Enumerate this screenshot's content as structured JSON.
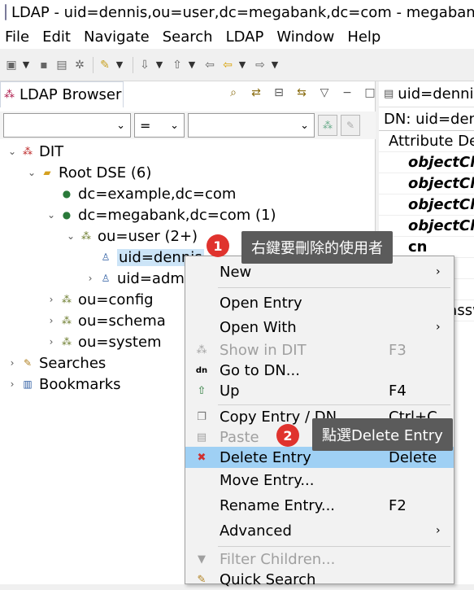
{
  "window": {
    "title": "LDAP - uid=dennis,ou=user,dc=megabank,dc=com - megabank - Apache Directory Studio"
  },
  "menubar": [
    "File",
    "Edit",
    "Navigate",
    "Search",
    "LDAP",
    "Window",
    "Help"
  ],
  "left_panel": {
    "tab_label": "LDAP Browser",
    "filter_combo_1": "",
    "filter_combo_2": "=",
    "filter_combo_3": "",
    "tree": {
      "dit": "DIT",
      "root_dse": "Root DSE (6)",
      "dc_example": "dc=example,dc=com",
      "dc_megabank": "dc=megabank,dc=com (1)",
      "ou_user": "ou=user (2+)",
      "uid_dennis": "uid=dennis",
      "uid_admin": "uid=admin",
      "ou_config": "ou=config",
      "ou_schema": "ou=schema",
      "ou_system": "ou=system",
      "searches": "Searches",
      "bookmarks": "Bookmarks"
    }
  },
  "right_panel": {
    "tab_label": "uid=dennis",
    "dn_label": "DN: uid=dennis",
    "header": "Attribute Description",
    "rows": [
      "objectClass",
      "objectClass",
      "objectClass",
      "objectClass",
      "cn",
      "",
      "",
      "userPassword"
    ]
  },
  "context_menu": {
    "items": [
      {
        "label": "New",
        "shortcut": "",
        "submenu": true,
        "disabled": false,
        "icon": ""
      },
      {
        "label": "Open Entry",
        "shortcut": "",
        "submenu": false,
        "disabled": false,
        "icon": ""
      },
      {
        "label": "Open With",
        "shortcut": "",
        "submenu": true,
        "disabled": false,
        "icon": ""
      },
      {
        "label": "Show in DIT",
        "shortcut": "F3",
        "submenu": false,
        "disabled": true,
        "icon": "show-in-dit-icon"
      },
      {
        "label": "Go to DN...",
        "shortcut": "",
        "submenu": false,
        "disabled": false,
        "icon": "goto-dn-icon"
      },
      {
        "label": "Up",
        "shortcut": "F4",
        "submenu": false,
        "disabled": false,
        "icon": "up-icon"
      },
      {
        "label": "Copy Entry / DN",
        "shortcut": "Ctrl+C",
        "submenu": false,
        "disabled": false,
        "icon": "copy-icon"
      },
      {
        "label": "Paste",
        "shortcut": "",
        "submenu": false,
        "disabled": true,
        "icon": "paste-icon"
      },
      {
        "label": "Delete Entry",
        "shortcut": "Delete",
        "submenu": false,
        "disabled": false,
        "icon": "delete-icon"
      },
      {
        "label": "Move Entry...",
        "shortcut": "",
        "submenu": false,
        "disabled": false,
        "icon": ""
      },
      {
        "label": "Rename Entry...",
        "shortcut": "F2",
        "submenu": false,
        "disabled": false,
        "icon": ""
      },
      {
        "label": "Advanced",
        "shortcut": "",
        "submenu": true,
        "disabled": false,
        "icon": ""
      },
      {
        "label": "Filter Children...",
        "shortcut": "",
        "submenu": false,
        "disabled": true,
        "icon": "filter-icon"
      },
      {
        "label": "Quick Search",
        "shortcut": "",
        "submenu": false,
        "disabled": false,
        "icon": "quick-search-icon"
      }
    ],
    "highlight_color": "#9fd0f4"
  },
  "annotations": [
    {
      "number": "1",
      "text": "右鍵要刪除的使用者"
    },
    {
      "number": "2",
      "text": "點選Delete Entry"
    }
  ],
  "colors": {
    "badge": "#e0332e",
    "callout_bg": "#5b5b5b",
    "selection": "#cce4f7"
  }
}
